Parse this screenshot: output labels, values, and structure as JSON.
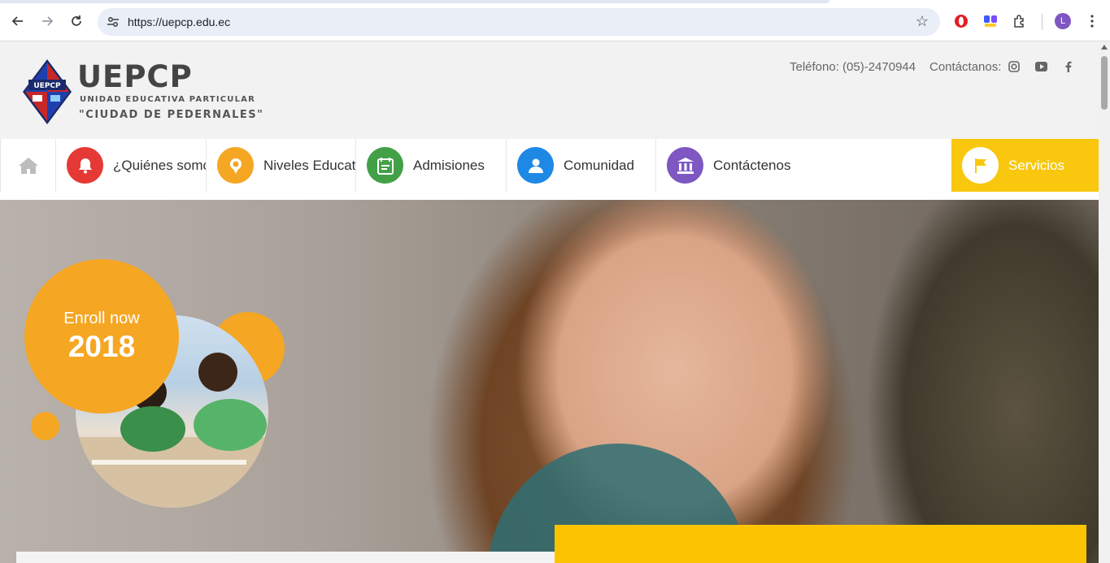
{
  "browser": {
    "url": "https://uepcp.edu.ec",
    "profile_initial": "L"
  },
  "header": {
    "brand": "UEPCP",
    "logo_text": "UEPCP",
    "subtitle": "UNIDAD EDUCATIVA PARTICULAR",
    "subtitle2": "\"CIUDAD DE PEDERNALES\"",
    "phone": "Teléfono: (05)-2470944",
    "contact_label": "Contáctanos:",
    "social_icons": [
      "instagram-icon",
      "youtube-icon",
      "facebook-icon"
    ]
  },
  "menu": {
    "items": [
      {
        "label": "¿Quiénes somos?",
        "icon": "bell-icon",
        "color": "#e53935"
      },
      {
        "label": "Niveles Educativos",
        "icon": "award-icon",
        "color": "#f5a623"
      },
      {
        "label": "Admisiones",
        "icon": "calendar-icon",
        "color": "#43a047"
      },
      {
        "label": "Comunidad",
        "icon": "user-icon",
        "color": "#1e88e5"
      },
      {
        "label": "Contáctenos",
        "icon": "bank-icon",
        "color": "#7e57c2"
      }
    ],
    "services_label": "Servicios",
    "services_color": "#f9c80e"
  },
  "hero": {
    "enroll_line1": "Enroll now",
    "enroll_line2": "2018",
    "accent": "#f5a623"
  }
}
